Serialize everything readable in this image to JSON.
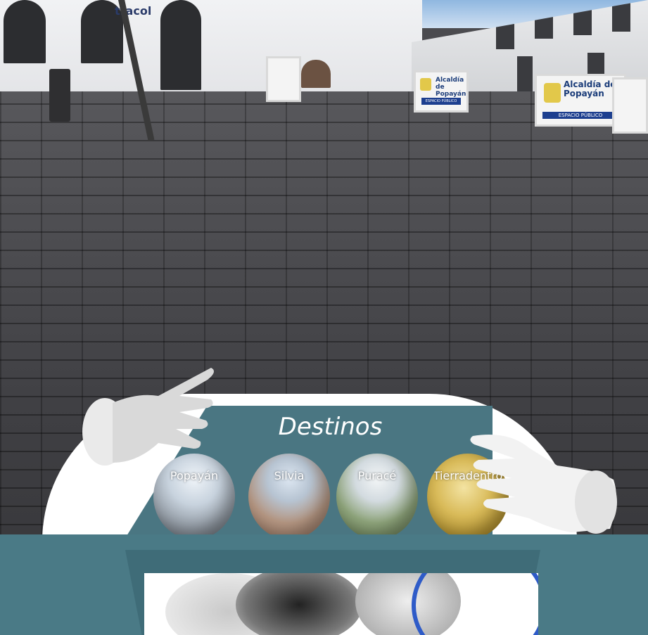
{
  "scene": {
    "signs": [
      {
        "line1": "Alcaldía de",
        "line2": "Popayán",
        "band": "ESPACIO PÚBLICO"
      },
      {
        "line1": "Alcaldía de",
        "line2": "Popayán",
        "band": "ESPACIO PÚBLICO"
      }
    ],
    "storefront_text": "tracol"
  },
  "menu": {
    "title": "Destinos",
    "destinations": [
      {
        "label": "Popayán",
        "colors": [
          "#dfe8f2",
          "#9aa3ad",
          "#6f757c"
        ]
      },
      {
        "label": "Silvia",
        "colors": [
          "#c9d6e6",
          "#b89a85",
          "#a07762"
        ]
      },
      {
        "label": "Puracé",
        "colors": [
          "#e7edf0",
          "#8aa07a",
          "#6a7f55"
        ]
      },
      {
        "label": "Tierradentro",
        "colors": [
          "#e9d58a",
          "#c9a743",
          "#9c7d22"
        ]
      }
    ]
  },
  "hands": {
    "left": "left-hand-icon",
    "right": "right-hand-icon"
  },
  "colors": {
    "panel": "#4a7682",
    "panel_front": "#4a7a86",
    "pavement": "#4a4a4e"
  }
}
